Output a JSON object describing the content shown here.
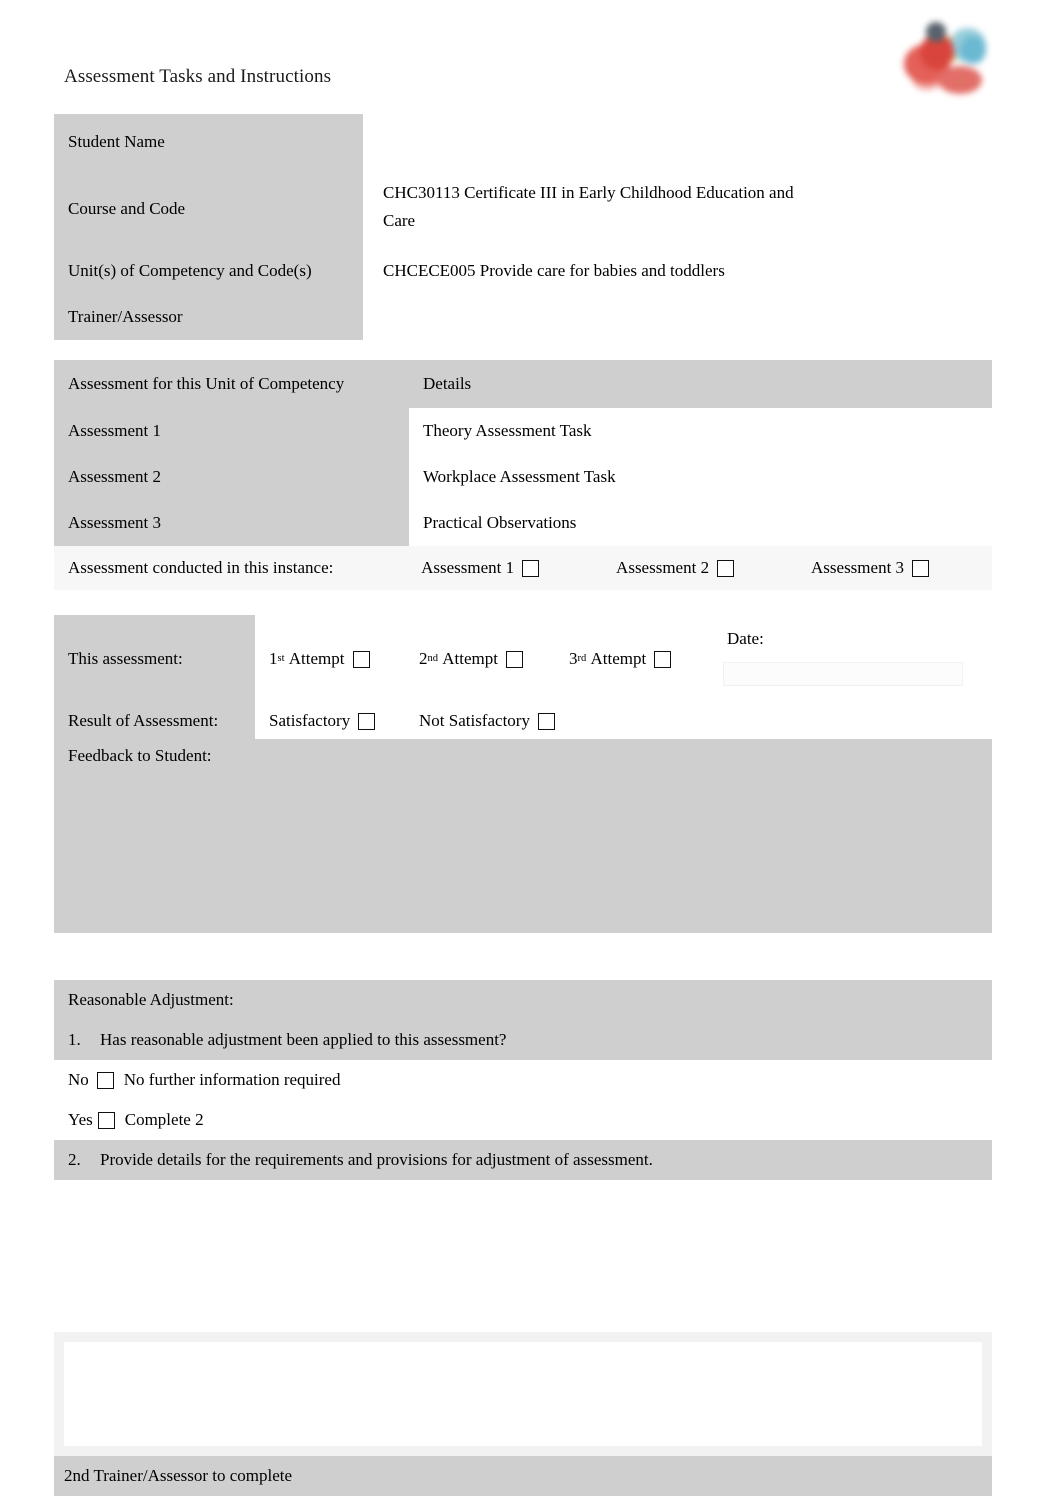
{
  "document": {
    "title": "Assessment Tasks and Instructions",
    "logo_name": "organisation-logo"
  },
  "details_table": {
    "rows": [
      {
        "label": "Student Name",
        "value": ""
      },
      {
        "label": "Course and Code",
        "value": "CHC30113 Certificate III in Early Childhood Education and",
        "value_line2": "Care"
      },
      {
        "label": "Unit(s) of Competency and Code(s)",
        "value": "CHCECE005 Provide care for babies and toddlers"
      },
      {
        "label": "Trainer/Assessor",
        "value": ""
      }
    ]
  },
  "assessment_table": {
    "header": {
      "col1": "Assessment for this Unit of Competency",
      "col2": "Details"
    },
    "rows": [
      {
        "name": "Assessment 1",
        "detail": "Theory Assessment Task"
      },
      {
        "name": "Assessment 2",
        "detail": "Workplace Assessment Task"
      },
      {
        "name": "Assessment 3",
        "detail": "Practical Observations"
      }
    ],
    "conducted": {
      "label": "Assessment conducted in this instance:",
      "options": [
        "Assessment 1",
        "Assessment 2",
        "Assessment 3"
      ]
    }
  },
  "attempt_table": {
    "this_assessment_label": "This assessment:",
    "attempts": [
      {
        "ordinal": "1",
        "suffix": "st",
        "label": "Attempt"
      },
      {
        "ordinal": "2",
        "suffix": "nd",
        "label": "Attempt"
      },
      {
        "ordinal": "3",
        "suffix": "rd",
        "label": "Attempt"
      }
    ],
    "date_label": "Date:",
    "date_value": "",
    "result_label": "Result of Assessment:",
    "result_options": [
      "Satisfactory",
      "Not Satisfactory"
    ],
    "feedback_label": "Feedback to Student:",
    "feedback_value": ""
  },
  "adjustment_table": {
    "heading": "Reasonable Adjustment:",
    "q1_number": "1.",
    "q1_text": "Has reasonable adjustment been applied to this assessment?",
    "no_label": "No",
    "no_text": "No further information required",
    "yes_label": "Yes",
    "yes_text": "Complete 2",
    "q2_number": "2.",
    "q2_text": "Provide details for the requirements and provisions for adjustment of assessment."
  },
  "bottom_block": {
    "notes_value": "",
    "footer_label": "2nd Trainer/Assessor to complete"
  }
}
